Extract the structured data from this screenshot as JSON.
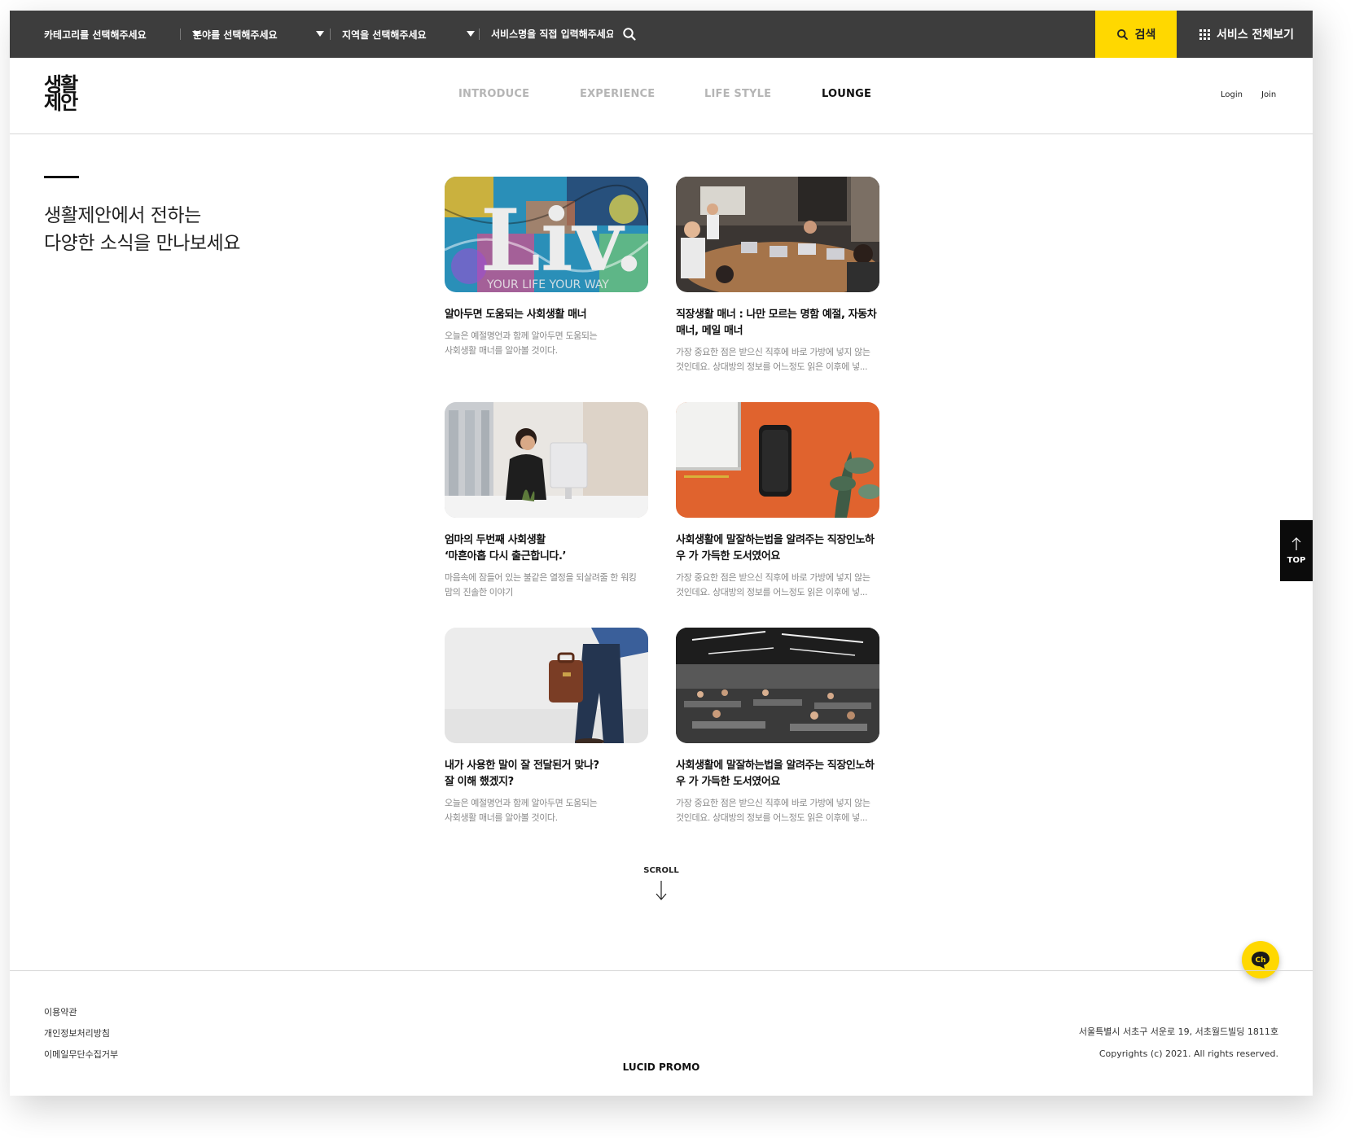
{
  "topbar": {
    "category_select": "카테고리를 선택해주세요",
    "field_select": "분야를 선택해주세요",
    "region_select": "지역을 선택해주세요",
    "service_input_placeholder": "서비스명을 직접 입력해주세요",
    "search_button": "검색",
    "all_services_button": "서비스 전체보기",
    "accent_color": "#ffd800",
    "bar_color": "#3d3d3d"
  },
  "header": {
    "logo_line1": "생활",
    "logo_line2": "제안",
    "nav": [
      "INTRODUCE",
      "EXPERIENCE",
      "LIFE STYLE",
      "LOUNGE"
    ],
    "active_nav": "LOUNGE",
    "login": "Login",
    "join": "Join"
  },
  "intro": {
    "line1": "생활제안에서 전하는",
    "line2": "다양한 소식을 만나보세요"
  },
  "cards": [
    {
      "image": "liv-mural",
      "image_text": "Liv.",
      "image_subtext": "YOUR LIFE YOUR WAY",
      "title": [
        "알아두면 도움되는 사회생활 매너"
      ],
      "desc": [
        "오늘은 예절명언과 함께 알아두면 도움되는",
        "사회생활 매너를 알아볼 것이다."
      ]
    },
    {
      "image": "meeting-room",
      "title": [
        "직장생활 매너 : 나만 모르는 명함 예절, 자동차",
        "매너, 메일 매너"
      ],
      "desc": [
        "가장 중요한 점은 받으신 직후에 바로 가방에 넣지 않는",
        "것인데요. 상대방의 정보를 어느정도 읽은 이후에 넣..."
      ]
    },
    {
      "image": "woman-desk",
      "title": [
        "엄마의 두번째 사회생활",
        "‘마흔아홉 다시 출근합니다.’"
      ],
      "desc": [
        "마음속에 잠들어 있는 불같은 열정을 되살려줄 한 워킹",
        "맘의 진솔한 이야기"
      ]
    },
    {
      "image": "orange-phone",
      "title": [
        "사회생활에 말잘하는법을 알려주는 직장인노하",
        "우 가 가득한 도서였어요"
      ],
      "desc": [
        "가장 중요한 점은 받으신 직후에 바로 가방에 넣지 않는",
        "것인데요. 상대방의 정보를 어느정도 읽은 이후에 넣..."
      ]
    },
    {
      "image": "briefcase-walk",
      "title": [
        "내가 사용한 말이 잘 전달된거 맞나?",
        "잘 이해 했겠지?"
      ],
      "desc": [
        "오늘은 예절명언과 함께 알아두면 도움되는",
        "사회생활 매너를 알아볼 것이다."
      ]
    },
    {
      "image": "open-office",
      "title": [
        "사회생활에 말잘하는법을 알려주는 직장인노하",
        "우 가 가득한 도서였어요"
      ],
      "desc": [
        "가장 중요한 점은 받으신 직후에 바로 가방에 넣지 않는",
        "것인데요. 상대방의 정보를 어느정도 읽은 이후에 넣..."
      ]
    }
  ],
  "scroll_label": "SCROLL",
  "top_button": "TOP",
  "chat_button": "Ch",
  "footer": {
    "links": [
      "이용약관",
      "개인정보처리방침",
      "이메일무단수집거부"
    ],
    "brand": "LUCID PROMO",
    "address": "서울특별시 서초구 서운로 19, 서초월드빌딩 1811호",
    "copyright": "Copyrights (c) 2021. All rights reserved."
  }
}
